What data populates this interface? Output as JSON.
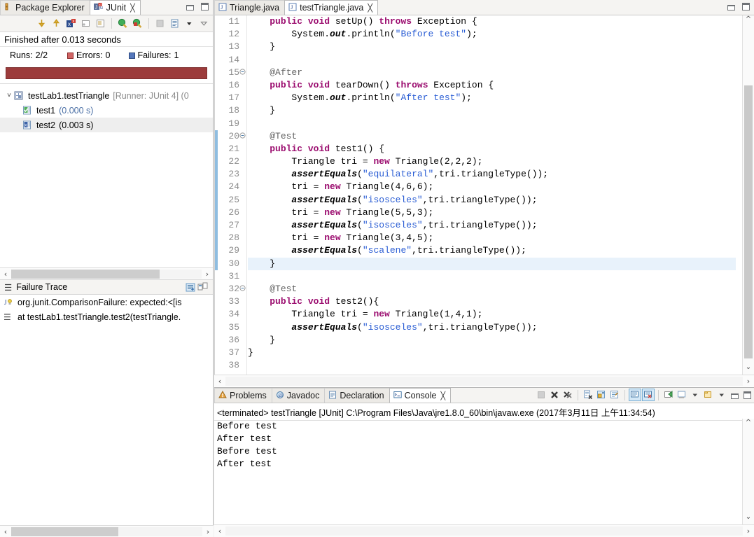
{
  "left_panel": {
    "tabs": [
      {
        "label": "Package Explorer",
        "icon": "package-explorer-icon",
        "active": false,
        "closable": false
      },
      {
        "label": "JUnit",
        "icon": "junit-icon",
        "active": true,
        "closable": true
      }
    ],
    "window_buttons": {
      "minimize": "minimize",
      "maximize": "maximize"
    },
    "toolbar_icons": [
      "next-failure-icon",
      "previous-failure-icon",
      "show-failures-only-icon",
      "rerun-test-icon",
      "rerun-failed-tests-icon",
      "history-icon",
      "stop-icon",
      "show-in-console-icon",
      "view-menu-icon",
      "minimize-view-icon"
    ],
    "status_text": "Finished after 0.013 seconds",
    "counters": {
      "runs_label": "Runs:",
      "runs_value": "2/2",
      "errors_label": "Errors:",
      "errors_value": "0",
      "failures_label": "Failures:",
      "failures_value": "1"
    },
    "progress_color": "#9c3b3b",
    "tree": [
      {
        "label": "testLab1.testTriangle",
        "suffix": "[Runner: JUnit 4] (0",
        "indent": 0,
        "icon": "test-suite-failed-icon",
        "expanded": true,
        "selected": false,
        "time": ""
      },
      {
        "label": "test1",
        "suffix": "",
        "indent": 1,
        "icon": "test-passed-icon",
        "expanded": false,
        "selected": false,
        "time": "(0.000 s)"
      },
      {
        "label": "test2",
        "suffix": "",
        "indent": 1,
        "icon": "test-failed-icon",
        "expanded": false,
        "selected": true,
        "time": "(0.003 s)"
      }
    ],
    "failure_trace": {
      "title": "Failure Trace",
      "icons": [
        "filter-stack-trace-icon",
        "compare-result-icon"
      ],
      "entries": [
        {
          "icon": "exception-icon",
          "text": "org.junit.ComparisonFailure: expected:<[is"
        },
        {
          "icon": "stack-frame-icon",
          "text": "at testLab1.testTriangle.test2(testTriangle."
        }
      ]
    }
  },
  "editor": {
    "tabs": [
      {
        "label": "Triangle.java",
        "icon": "java-file-icon",
        "active": false,
        "closable": false
      },
      {
        "label": "testTriangle.java",
        "icon": "java-file-icon",
        "active": true,
        "closable": true
      }
    ],
    "window_buttons": {
      "minimize": "minimize",
      "maximize": "maximize"
    },
    "highlight_line": 30,
    "lines": [
      {
        "n": 11,
        "fold": false,
        "marker": false,
        "text": "    public void setUp() throws Exception {"
      },
      {
        "n": 12,
        "fold": false,
        "marker": false,
        "text": "        System.out.println(\"Before test\");"
      },
      {
        "n": 13,
        "fold": false,
        "marker": false,
        "text": "    }"
      },
      {
        "n": 14,
        "fold": false,
        "marker": false,
        "text": ""
      },
      {
        "n": 15,
        "fold": true,
        "marker": false,
        "text": "    @After"
      },
      {
        "n": 16,
        "fold": false,
        "marker": false,
        "text": "    public void tearDown() throws Exception {"
      },
      {
        "n": 17,
        "fold": false,
        "marker": false,
        "text": "        System.out.println(\"After test\");"
      },
      {
        "n": 18,
        "fold": false,
        "marker": false,
        "text": "    }"
      },
      {
        "n": 19,
        "fold": false,
        "marker": false,
        "text": ""
      },
      {
        "n": 20,
        "fold": true,
        "marker": true,
        "text": "    @Test"
      },
      {
        "n": 21,
        "fold": false,
        "marker": true,
        "text": "    public void test1() {"
      },
      {
        "n": 22,
        "fold": false,
        "marker": true,
        "text": "        Triangle tri = new Triangle(2,2,2);"
      },
      {
        "n": 23,
        "fold": false,
        "marker": true,
        "text": "        assertEquals(\"equilateral\",tri.triangleType());"
      },
      {
        "n": 24,
        "fold": false,
        "marker": true,
        "text": "        tri = new Triangle(4,6,6);"
      },
      {
        "n": 25,
        "fold": false,
        "marker": true,
        "text": "        assertEquals(\"isosceles\",tri.triangleType());"
      },
      {
        "n": 26,
        "fold": false,
        "marker": true,
        "text": "        tri = new Triangle(5,5,3);"
      },
      {
        "n": 27,
        "fold": false,
        "marker": true,
        "text": "        assertEquals(\"isosceles\",tri.triangleType());"
      },
      {
        "n": 28,
        "fold": false,
        "marker": true,
        "text": "        tri = new Triangle(3,4,5);"
      },
      {
        "n": 29,
        "fold": false,
        "marker": true,
        "text": "        assertEquals(\"scalene\",tri.triangleType());"
      },
      {
        "n": 30,
        "fold": false,
        "marker": true,
        "text": "    }"
      },
      {
        "n": 31,
        "fold": false,
        "marker": false,
        "text": ""
      },
      {
        "n": 32,
        "fold": true,
        "marker": false,
        "text": "    @Test"
      },
      {
        "n": 33,
        "fold": false,
        "marker": false,
        "text": "    public void test2(){"
      },
      {
        "n": 34,
        "fold": false,
        "marker": false,
        "text": "        Triangle tri = new Triangle(1,4,1);"
      },
      {
        "n": 35,
        "fold": false,
        "marker": false,
        "text": "        assertEquals(\"isosceles\",tri.triangleType());"
      },
      {
        "n": 36,
        "fold": false,
        "marker": false,
        "text": "    }"
      },
      {
        "n": 37,
        "fold": false,
        "marker": false,
        "text": "}"
      },
      {
        "n": 38,
        "fold": false,
        "marker": false,
        "text": ""
      }
    ]
  },
  "console": {
    "tabs": [
      {
        "label": "Problems",
        "icon": "problems-icon",
        "active": false,
        "closable": false
      },
      {
        "label": "Javadoc",
        "icon": "javadoc-icon",
        "active": false,
        "closable": false
      },
      {
        "label": "Declaration",
        "icon": "declaration-icon",
        "active": false,
        "closable": false
      },
      {
        "label": "Console",
        "icon": "console-icon",
        "active": true,
        "closable": true
      }
    ],
    "toolbar_icons": [
      "terminate-icon",
      "remove-launch-icon",
      "remove-all-terminated-icon",
      "clear-console-icon",
      "scroll-lock-icon",
      "word-wrap-icon",
      "show-console-on-output-icon",
      "show-console-on-error-icon",
      "pin-console-icon",
      "display-selected-console-icon",
      "display-selected-console-menu-icon",
      "open-console-icon",
      "open-console-menu-icon"
    ],
    "window_buttons": {
      "minimize": "minimize",
      "maximize": "maximize"
    },
    "launch_line": "<terminated> testTriangle [JUnit] C:\\Program Files\\Java\\jre1.8.0_60\\bin\\javaw.exe (2017年3月11日 上午11:34:54)",
    "output": "Before test\nAfter test\nBefore test\nAfter test"
  }
}
